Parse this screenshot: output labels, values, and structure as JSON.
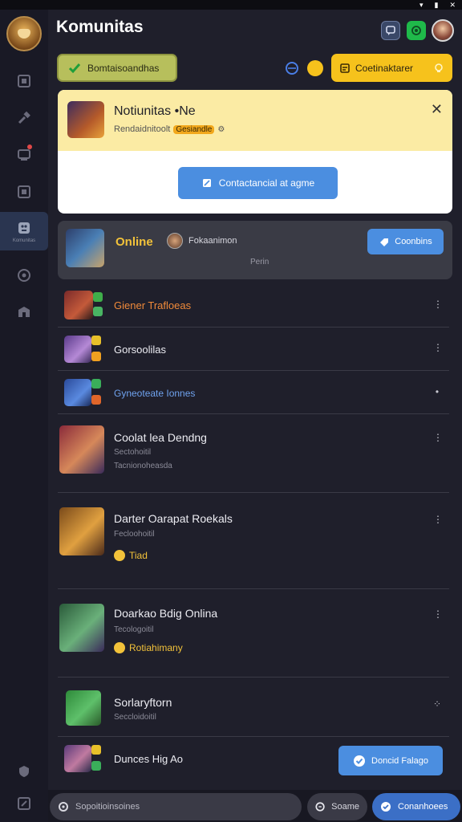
{
  "app": {
    "title": "Komunitas"
  },
  "status_bar": {
    "icons": [
      "wifi-icon",
      "battery-icon",
      "close-icon"
    ]
  },
  "sidebar": {
    "items": [
      {
        "icon": "grid-icon",
        "label": ""
      },
      {
        "icon": "hammer-icon",
        "label": ""
      },
      {
        "icon": "devices-icon",
        "label": "",
        "badge": true
      },
      {
        "icon": "square-icon",
        "label": ""
      },
      {
        "icon": "community-icon",
        "label": "Komunitas",
        "active": true
      },
      {
        "icon": "compass-icon",
        "label": ""
      },
      {
        "icon": "store-icon",
        "label": ""
      }
    ],
    "footer": [
      {
        "icon": "shield-icon"
      },
      {
        "icon": "settings-icon"
      }
    ]
  },
  "header": {
    "chat_icon": "chat-icon",
    "phone_icon": "phone-icon"
  },
  "top_actions": {
    "green_pill_label": "Bomtaisoandhas",
    "yellow_pill_label": "Coetinaktarer",
    "status_blue_icon": "globe-icon",
    "status_yellow_icon": "coin-icon"
  },
  "notification": {
    "title": "Notiunitas •Ne",
    "subtitle_text": "Rendaidnitoolt",
    "subtitle_chip": "Gesiandle",
    "action_label": "Contactancial at agme",
    "close_icon": "close-icon"
  },
  "online_card": {
    "label": "Online",
    "name": "Fokaanimon",
    "sub": "Perin",
    "button_label": "Coonbins"
  },
  "list": [
    {
      "title": "Giener Trafloeas",
      "title_color": "#f08a3a",
      "sub": "",
      "tag": ""
    },
    {
      "title": "Gorsoolilas",
      "title_color": "#ececf2",
      "sub": "",
      "tag": ""
    },
    {
      "title": "Gyneoteate Ionnes",
      "title_color": "#6fa2ee",
      "sub": "",
      "tag": ""
    },
    {
      "title": "Coolat lea Dendng",
      "title_color": "#ececf2",
      "sub": "Sectohoitil",
      "sub2": "Tacnionoheasda",
      "tag": ""
    },
    {
      "title": "Darter Oarapat Roekals",
      "title_color": "#ececf2",
      "sub": "Fecloohoitil",
      "tag": "Tiad"
    },
    {
      "title": "Doarkao Bdig Onlina",
      "title_color": "#ececf2",
      "sub": "Tecologoitil",
      "tag": "Rotiahimany"
    },
    {
      "title": "Sorlaryftorn",
      "title_color": "#ececf2",
      "sub": "Seccloidoitil",
      "tag": ""
    },
    {
      "title": "Dunces Hig Ao",
      "title_color": "#ececf2",
      "sub": "",
      "tag": ""
    }
  ],
  "floating_button": {
    "label": "Doncid Falago"
  },
  "bottom_bar": {
    "search_placeholder": "Sopoitioinsoines",
    "middle_label": "Soame",
    "right_label": "Conanhoees"
  }
}
